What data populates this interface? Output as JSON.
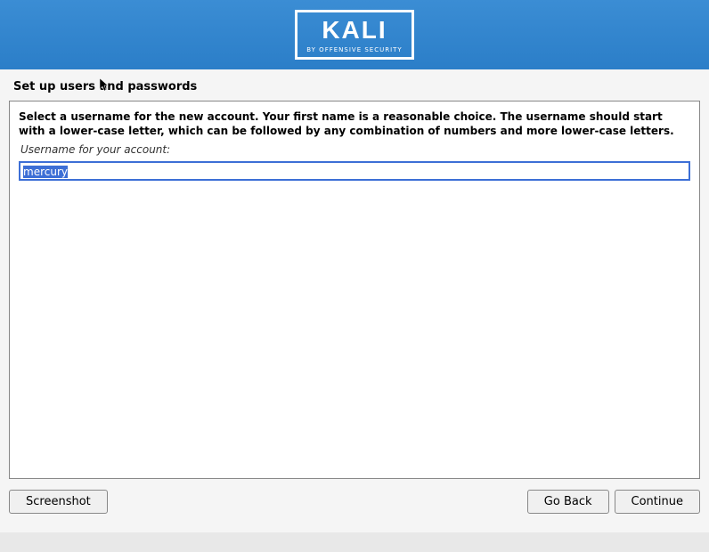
{
  "header": {
    "logo_text": "KALI",
    "logo_subtitle": "BY OFFENSIVE SECURITY"
  },
  "page": {
    "title": "Set up users and passwords"
  },
  "content": {
    "instruction": "Select a username for the new account. Your first name is a reasonable choice. The username should start with a lower-case letter, which can be followed by any combination of numbers and more lower-case letters.",
    "field_label": "Username for your account:",
    "username_value": "mercury"
  },
  "buttons": {
    "screenshot": "Screenshot",
    "go_back": "Go Back",
    "continue": "Continue"
  }
}
